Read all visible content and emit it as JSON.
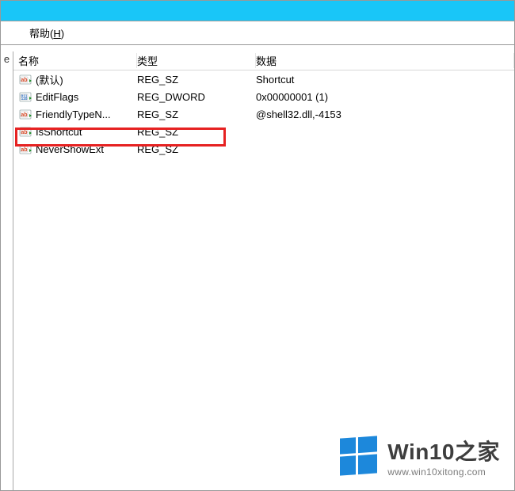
{
  "menu": {
    "left_edge_label": "",
    "help_label": "帮助",
    "help_mnemonic": "H"
  },
  "left_panel_text": "e",
  "columns": {
    "name_header": "名称",
    "type_header": "类型",
    "data_header": "数据"
  },
  "rows": [
    {
      "icon": "string",
      "name": "(默认)",
      "type": "REG_SZ",
      "data": "Shortcut"
    },
    {
      "icon": "dword",
      "name": "EditFlags",
      "type": "REG_DWORD",
      "data": "0x00000001 (1)"
    },
    {
      "icon": "string",
      "name": "FriendlyTypeN...",
      "type": "REG_SZ",
      "data": "@shell32.dll,-4153"
    },
    {
      "icon": "string",
      "name": "IsShortcut",
      "type": "REG_SZ",
      "data": ""
    },
    {
      "icon": "string",
      "name": "NeverShowExt",
      "type": "REG_SZ",
      "data": ""
    }
  ],
  "highlight_row_index": 3,
  "watermark": {
    "main_text": "Win10之家",
    "sub_text": "www.win10xitong.com"
  }
}
